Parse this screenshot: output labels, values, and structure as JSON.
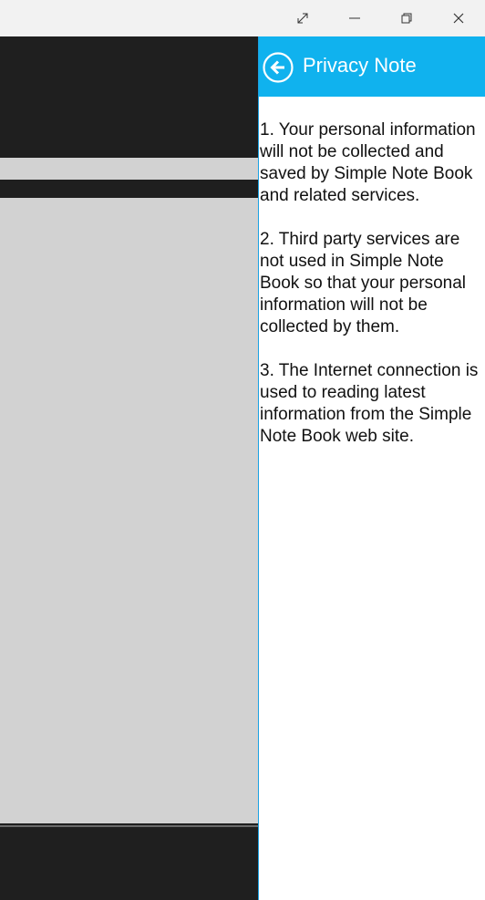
{
  "titlebar": {
    "icons": {
      "fullscreen": "expand-icon",
      "minimize": "minimize-icon",
      "maximize": "restore-icon",
      "close": "close-icon"
    }
  },
  "flyout": {
    "title": "Privacy Note",
    "back_icon": "back-arrow-circle-icon",
    "header_color": "#10b2ee",
    "paragraphs": [
      "1. Your personal information will not be collected and saved by Simple Note Book and related services.",
      "2. Third party services are not used in Simple Note Book so that your personal information will not be collected by them.",
      "3. The Internet connection is used to reading latest information from the Simple Note Book web site."
    ]
  }
}
